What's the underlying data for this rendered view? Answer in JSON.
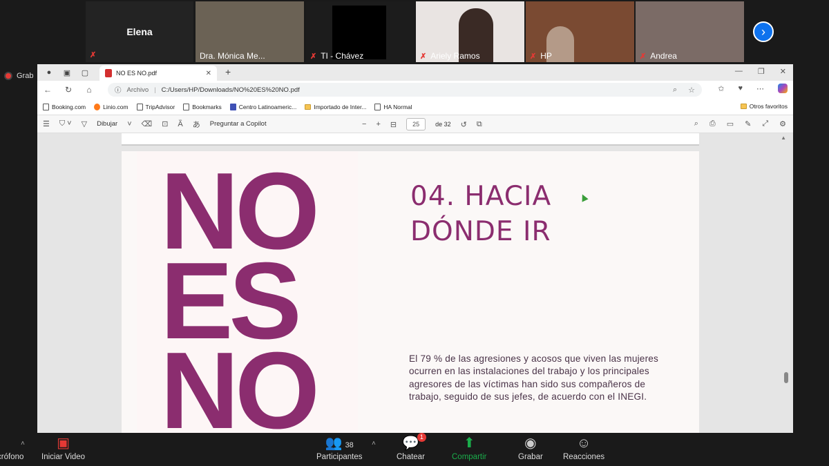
{
  "participants": [
    {
      "name": "Elena"
    },
    {
      "name": "Dra. Mónica Me..."
    },
    {
      "name": "TI - Chávez"
    },
    {
      "name": "Ariely Ramos"
    },
    {
      "name": "HP"
    },
    {
      "name": "Andrea"
    }
  ],
  "recording_label": "Grab",
  "browser": {
    "tab_title": "NO ES NO.pdf",
    "url_prefix": "Archivo",
    "url": "C:/Users/HP/Downloads/NO%20ES%20NO.pdf",
    "favorites": [
      "Booking.com",
      "Linio.com",
      "TripAdvisor",
      "Bookmarks",
      "Centro Latinoameric...",
      "Importado de Inter...",
      "HA Normal"
    ],
    "favorites_other": "Otros favoritos"
  },
  "pdf_toolbar": {
    "draw_label": "Dibujar",
    "copilot_label": "Preguntar a Copilot",
    "current_page": "25",
    "page_of": "de 32"
  },
  "pdf_page": {
    "big_words": [
      "NO",
      "ES",
      "NO"
    ],
    "heading_line1": "04. HACIA",
    "heading_line2": "DÓNDE IR",
    "body": "El 79 % de las agresiones y acosos que viven las mujeres ocurren en las instalaciones del trabajo y los principales agresores de las víctimas han sido sus compañeros de trabajo, seguido de sus jefes, de acuerdo con el INEGI."
  },
  "zoom_bar": {
    "mic_label": "crófono",
    "video_label": "Iniciar Video",
    "participants_label": "Participantes",
    "participants_count": "38",
    "chat_label": "Chatear",
    "chat_badge": "1",
    "share_label": "Compartir",
    "record_label": "Grabar",
    "reactions_label": "Reacciones"
  },
  "colors": {
    "accent": "#8b2d6f",
    "zoom_blue": "#0e72ed",
    "share_green": "#1aad4b"
  }
}
